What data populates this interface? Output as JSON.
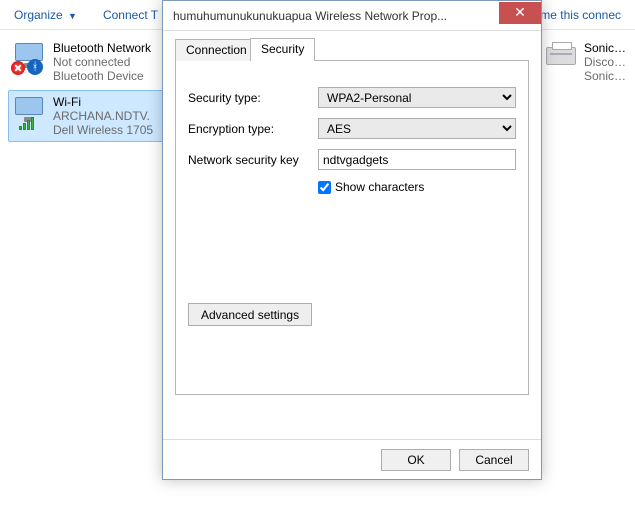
{
  "toolbar": {
    "organize": "Organize",
    "connectTo": "Connect T",
    "rename": "name this connec"
  },
  "networks": {
    "left": [
      {
        "title": "Bluetooth Network",
        "sub1": "Not connected",
        "sub2": "Bluetooth Device"
      },
      {
        "title": "Wi-Fi",
        "sub1": "ARCHANA.NDTV.",
        "sub2": "Dell Wireless 1705"
      }
    ],
    "right": [
      {
        "title": "SonicWALL I",
        "sub1": "Disconnecte",
        "sub2": "SonicWALL I"
      }
    ]
  },
  "dialog": {
    "title": "humuhumunukunukuapua Wireless Network Prop...",
    "tabs": {
      "connection": "Connection",
      "security": "Security",
      "active": 1
    },
    "fields": {
      "securityTypeLabel": "Security type:",
      "securityTypeValue": "WPA2-Personal",
      "encryptionTypeLabel": "Encryption type:",
      "encryptionTypeValue": "AES",
      "keyLabel": "Network security key",
      "keyValue": "ndtvgadgets",
      "showCharsLabel": "Show characters",
      "showCharsChecked": true
    },
    "advanced": "Advanced settings",
    "buttons": {
      "ok": "OK",
      "cancel": "Cancel"
    }
  }
}
